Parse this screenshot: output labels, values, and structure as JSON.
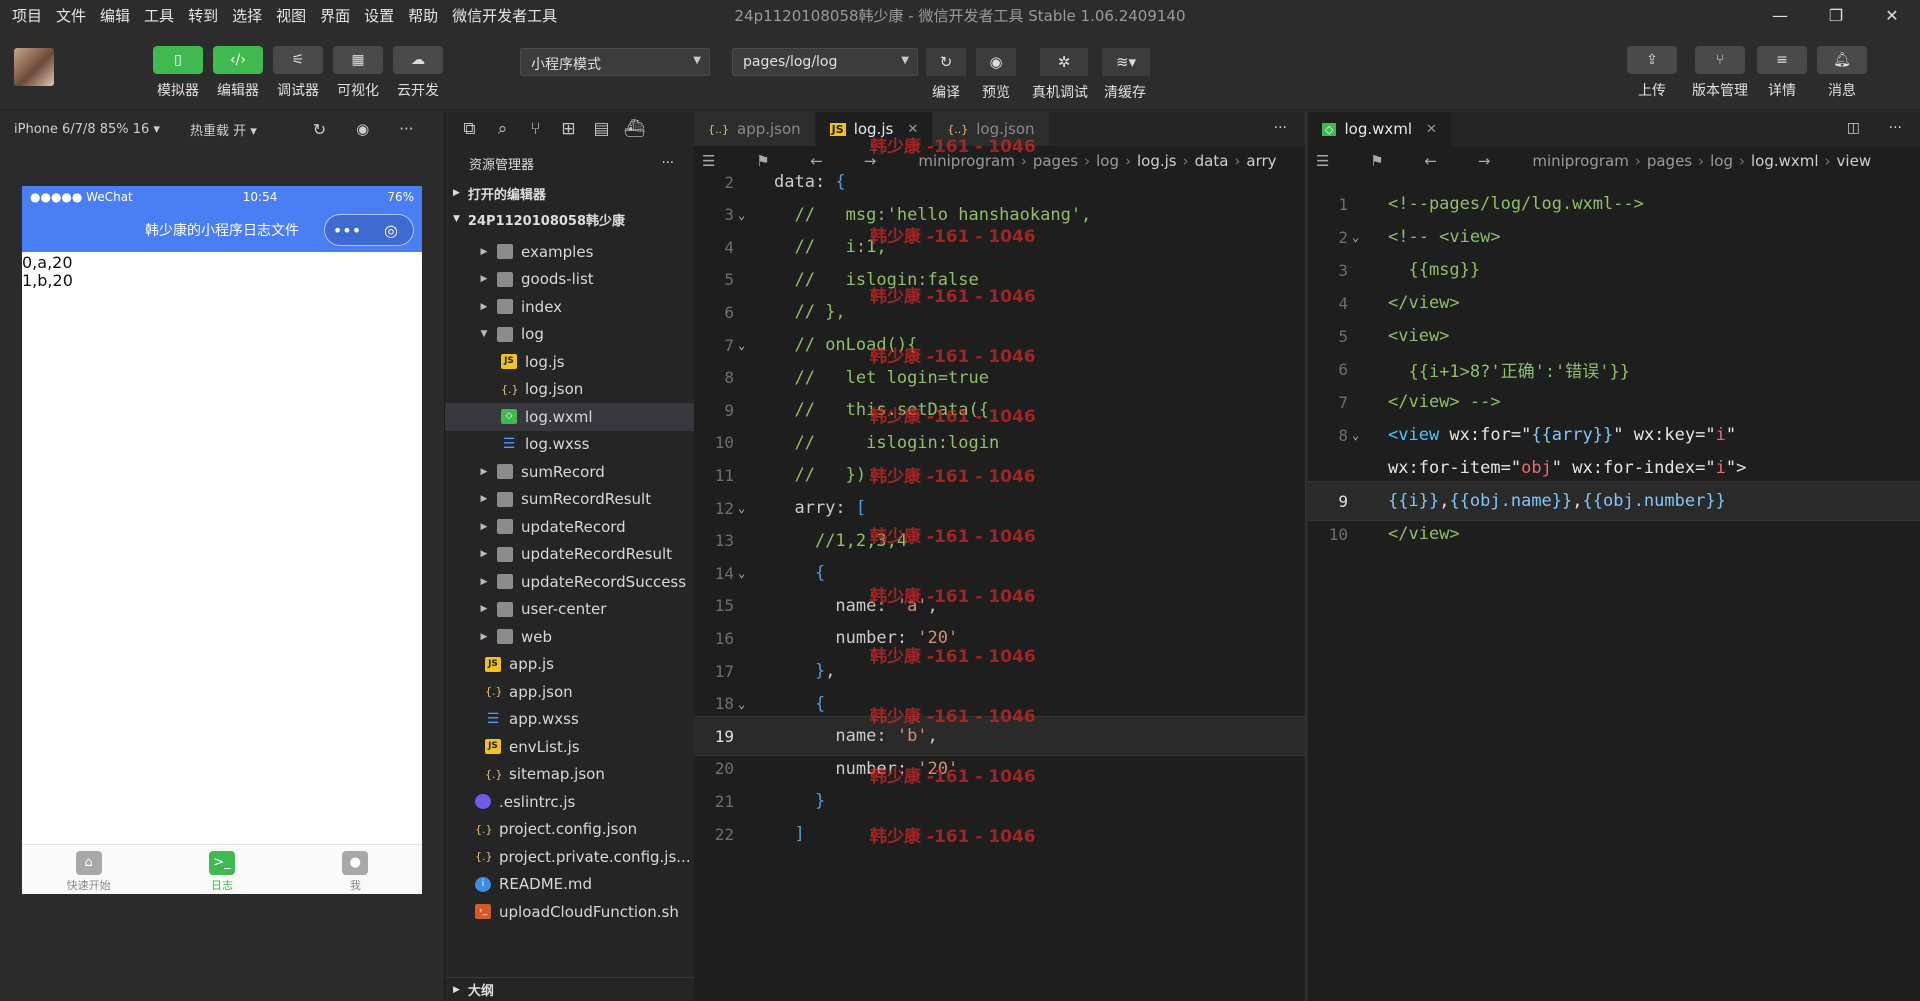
{
  "menu": {
    "items": [
      "项目",
      "文件",
      "编辑",
      "工具",
      "转到",
      "选择",
      "视图",
      "界面",
      "设置",
      "帮助",
      "微信开发者工具"
    ],
    "window_title": "24p1120108058韩少康 - 微信开发者工具 Stable 1.06.2409140"
  },
  "toolbar": {
    "simulator": "模拟器",
    "editor": "编辑器",
    "debugger": "调试器",
    "visual": "可视化",
    "cloud": "云开发",
    "mode_select": "小程序模式",
    "page_select": "pages/log/log",
    "compile": "编译",
    "preview": "预览",
    "real_debug": "真机调试",
    "clear_cache": "清缓存",
    "upload": "上传",
    "version": "版本管理",
    "details": "详情",
    "messages": "消息"
  },
  "simulator": {
    "device": "iPhone 6/7/8 85% 16 ▾",
    "hot_reload": "热重载 开 ▾",
    "status_left": "●●●●● WeChat",
    "status_time": "10:54",
    "status_battery": "76%",
    "nav_title": "韩少康的小程序日志文件",
    "content_lines": [
      "0,a,20",
      "1,b,20"
    ],
    "tabs": [
      {
        "label": "快速开始",
        "icon": "home-icon"
      },
      {
        "label": "日志",
        "icon": "terminal-icon"
      },
      {
        "label": "我",
        "icon": "user-icon"
      }
    ]
  },
  "explorer": {
    "title": "资源管理器",
    "open_editors": "打开的编辑器",
    "project": "24P1120108058韩少康",
    "outline": "大纲",
    "items": [
      {
        "name": "examples",
        "type": "folder",
        "depth": 1
      },
      {
        "name": "goods-list",
        "type": "folder",
        "depth": 1
      },
      {
        "name": "index",
        "type": "folder",
        "depth": 1
      },
      {
        "name": "log",
        "type": "folder-open",
        "depth": 1
      },
      {
        "name": "log.js",
        "type": "js",
        "depth": 2
      },
      {
        "name": "log.json",
        "type": "json",
        "depth": 2
      },
      {
        "name": "log.wxml",
        "type": "wxml",
        "depth": 2,
        "selected": true
      },
      {
        "name": "log.wxss",
        "type": "wxss",
        "depth": 2
      },
      {
        "name": "sumRecord",
        "type": "folder",
        "depth": 1
      },
      {
        "name": "sumRecordResult",
        "type": "folder",
        "depth": 1
      },
      {
        "name": "updateRecord",
        "type": "folder",
        "depth": 1
      },
      {
        "name": "updateRecordResult",
        "type": "folder",
        "depth": 1
      },
      {
        "name": "updateRecordSuccess",
        "type": "folder",
        "depth": 1
      },
      {
        "name": "user-center",
        "type": "folder",
        "depth": 1
      },
      {
        "name": "web",
        "type": "folder",
        "depth": 1
      },
      {
        "name": "app.js",
        "type": "js",
        "depth": 0
      },
      {
        "name": "app.json",
        "type": "json",
        "depth": 0
      },
      {
        "name": "app.wxss",
        "type": "wxss",
        "depth": 0
      },
      {
        "name": "envList.js",
        "type": "js",
        "depth": 0
      },
      {
        "name": "sitemap.json",
        "type": "json",
        "depth": 0
      },
      {
        "name": ".eslintrc.js",
        "type": "eslint",
        "depth": -1
      },
      {
        "name": "project.config.json",
        "type": "json",
        "depth": -1
      },
      {
        "name": "project.private.config.js...",
        "type": "json",
        "depth": -1
      },
      {
        "name": "README.md",
        "type": "md",
        "depth": -1
      },
      {
        "name": "uploadCloudFunction.sh",
        "type": "sh",
        "depth": -1
      }
    ]
  },
  "editor_left": {
    "tabs": [
      {
        "label": "app.json",
        "icon": "{..}",
        "active": false
      },
      {
        "label": "log.js",
        "icon": "JS",
        "active": true
      },
      {
        "label": "log.json",
        "icon": "{..}",
        "active": false
      }
    ],
    "breadcrumb": [
      "miniprogram",
      "pages",
      "log",
      "log.js",
      "data",
      "arry"
    ],
    "lines": [
      {
        "n": "2",
        "text": "data: {"
      },
      {
        "n": "3",
        "text": "  //   msg:'hello hanshaokang',"
      },
      {
        "n": "4",
        "text": "  //   i:1,"
      },
      {
        "n": "5",
        "text": "  //   islogin:false"
      },
      {
        "n": "6",
        "text": "  // },"
      },
      {
        "n": "7",
        "text": "  // onLoad(){"
      },
      {
        "n": "8",
        "text": "  //   let login=true"
      },
      {
        "n": "9",
        "text": "  //   this.setData({"
      },
      {
        "n": "10",
        "text": "  //     islogin:login"
      },
      {
        "n": "11",
        "text": "  //   })"
      },
      {
        "n": "12",
        "text": "  arry: ["
      },
      {
        "n": "13",
        "text": "    //1,2,3,4"
      },
      {
        "n": "14",
        "text": "    {"
      },
      {
        "n": "15",
        "text": "      name: 'a',"
      },
      {
        "n": "16",
        "text": "      number: '20'"
      },
      {
        "n": "17",
        "text": "    },"
      },
      {
        "n": "18",
        "text": "    {"
      },
      {
        "n": "19",
        "text": "      name: 'b',"
      },
      {
        "n": "20",
        "text": "      number: '20'"
      },
      {
        "n": "21",
        "text": "    }"
      },
      {
        "n": "22",
        "text": "  ]"
      }
    ],
    "watermark": "韩少康 -161 - 1046"
  },
  "editor_right": {
    "tabs": [
      {
        "label": "log.wxml",
        "icon": "wxml",
        "active": true
      }
    ],
    "breadcrumb": [
      "miniprogram",
      "pages",
      "log",
      "log.wxml",
      "view"
    ],
    "lines": [
      {
        "n": "1",
        "text": "<!--pages/log/log.wxml-->"
      },
      {
        "n": "2",
        "text": "<!-- <view>"
      },
      {
        "n": "3",
        "text": "  {{msg}}"
      },
      {
        "n": "4",
        "text": "</view>"
      },
      {
        "n": "5",
        "text": "<view>"
      },
      {
        "n": "6",
        "text": "  {{i+1>8?'正确':'错误'}}"
      },
      {
        "n": "7",
        "text": "</view> -->"
      },
      {
        "n": "8",
        "text": "<view wx:for=\"{{arry}}\" wx:key=\"i\""
      },
      {
        "n": "",
        "text": "wx:for-item=\"obj\" wx:for-index=\"i\">"
      },
      {
        "n": "9",
        "text": "{{i}},{{obj.name}},{{obj.number}}"
      },
      {
        "n": "10",
        "text": "</view>"
      }
    ]
  }
}
